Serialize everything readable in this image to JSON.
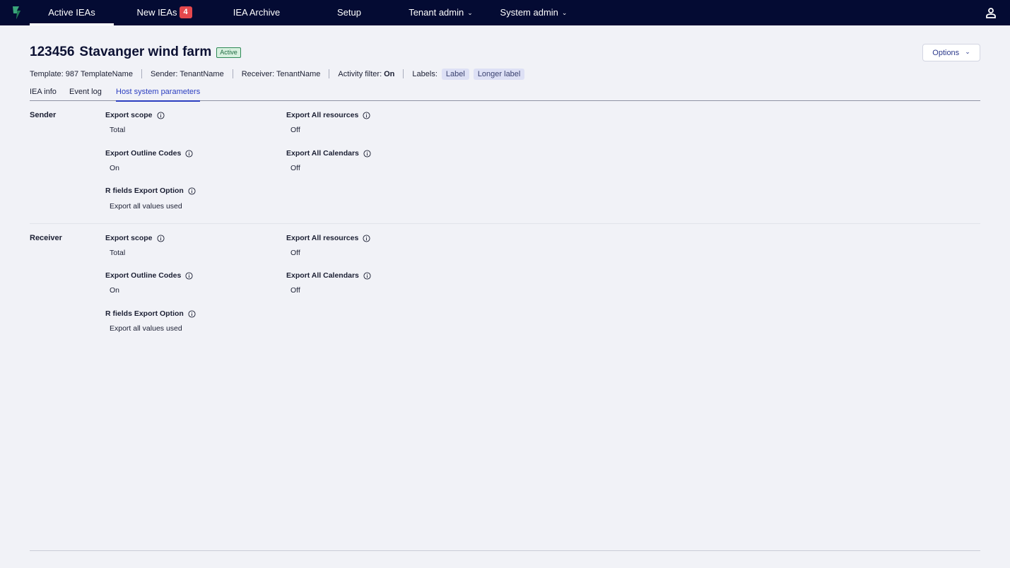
{
  "nav": {
    "items": [
      {
        "label": "Active IEAs"
      },
      {
        "label": "New IEAs",
        "badge": "4"
      },
      {
        "label": "IEA Archive"
      },
      {
        "label": "Setup"
      },
      {
        "label": "Tenant admin"
      },
      {
        "label": "System admin"
      }
    ],
    "accent": "#040b33"
  },
  "header": {
    "id": "123456",
    "name": "Stavanger wind farm",
    "status": "Active",
    "options_label": "Options"
  },
  "meta": {
    "template": "Template: 987 TemplateName",
    "sender": "Sender: TenantName",
    "receiver": "Receiver: TenantName",
    "activity_label": "Activity filter:",
    "activity_value": "On",
    "labels_label": "Labels:",
    "labels": [
      "Label",
      "Longer label"
    ]
  },
  "tabs": [
    "IEA info",
    "Event log",
    "Host system parameters"
  ],
  "sections": [
    {
      "title": "Sender",
      "fields": [
        {
          "label": "Export scope",
          "value": "Total"
        },
        {
          "label": "Export All resources",
          "value": "Off"
        },
        {
          "label": "Export Outline Codes",
          "value": "On"
        },
        {
          "label": "Export All Calendars",
          "value": "Off"
        },
        {
          "label": "R fields Export Option",
          "value": "Export all values used"
        }
      ]
    },
    {
      "title": "Receiver",
      "fields": [
        {
          "label": "Export scope",
          "value": "Total"
        },
        {
          "label": "Export All resources",
          "value": "Off"
        },
        {
          "label": "Export Outline Codes",
          "value": "On"
        },
        {
          "label": "Export All Calendars",
          "value": "Off"
        },
        {
          "label": "R fields Export Option",
          "value": "Export all values used"
        }
      ]
    }
  ]
}
